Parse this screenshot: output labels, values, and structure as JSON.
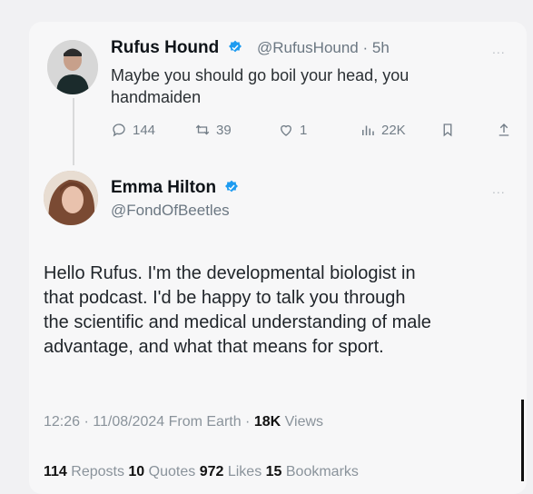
{
  "reply_to": {
    "name": "Rufus Hound",
    "handle": "@RufusHound",
    "time": "5h",
    "text_line1": "Maybe you should go boil your head, you",
    "text_line2": "handmaiden",
    "replies": "144",
    "reposts": "39",
    "likes": "1",
    "views": "22K",
    "more": "..."
  },
  "tweet": {
    "name": "Emma Hilton",
    "handle": "@FondOfBeetles",
    "more": "...",
    "lines": [
      "Hello Rufus. I'm the developmental biologist in",
      "that podcast. I'd be happy to talk you through",
      "the scientific and medical understanding of male",
      "advantage, and what that means for sport."
    ],
    "time": "12:26 · 11/08/2024 From Earth · ",
    "views_count": "18K",
    "views_label": " Views",
    "stats": {
      "reposts_count": "114",
      "reposts_label": " Reposts  ",
      "quotes_count": "10",
      "quotes_label": " Quotes  ",
      "likes_count": "972",
      "likes_label": " Likes  ",
      "bookmarks_count": "15",
      "bookmarks_label": " Bookmarks"
    }
  },
  "colors": {
    "verified": "#1d9bf0"
  }
}
